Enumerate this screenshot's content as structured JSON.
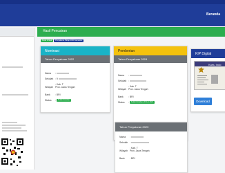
{
  "header": {
    "nav_home": "Beranda"
  },
  "main": {
    "title": "Hasil Pencairan",
    "tags": [
      "Kode Virtual",
      "Penyaluran Tahap 2024 Semester"
    ]
  },
  "cards": {
    "nominasi": {
      "title": "Nominasi",
      "subtitle": "Tahun Penyaluran 2022",
      "rows": [
        {
          "label": "Nama",
          "value": ":"
        },
        {
          "label": "Sekolah",
          "value": ": 9"
        },
        {
          "label": "Wilayah",
          "value": ": Kab. T\nProv. Jawa Tengah"
        },
        {
          "label": "Bank",
          "value": ": BRI"
        },
        {
          "label": "Status",
          "value": ":"
        }
      ],
      "status_badge": "Sudah Dicairkan"
    },
    "pemberian": {
      "title": "Pemberian",
      "subtitle": "Tahun Penyaluran 2024",
      "rows": [
        {
          "label": "Nama",
          "value": ":"
        },
        {
          "label": "Sekolah",
          "value": ":"
        },
        {
          "label": "Wilayah",
          "value": ": Kab. T\nProv. Jawa Tengah"
        },
        {
          "label": "Bank",
          "value": ": BRI"
        },
        {
          "label": "Status",
          "value": ":"
        }
      ],
      "status_badge": "Sudah Dicairkan 28 Juni 2024"
    },
    "tahun2023": {
      "subtitle": "Tahun Penyaluran 2023",
      "rows": [
        {
          "label": "Nama",
          "value": ":"
        },
        {
          "label": "Sekolah",
          "value": ":"
        },
        {
          "label": "Wilayah",
          "value": ": Kab. T\nProv. Jawa Tengah"
        },
        {
          "label": "Bank",
          "value": ": BRI"
        }
      ]
    }
  },
  "kip": {
    "title": "KIP Digital",
    "card_text": "Kartu Indo",
    "download": "Download"
  },
  "colors": {
    "topbar": "#1f3d99",
    "main_header": "#2dad4f",
    "nominasi": "#19b3c7",
    "pemberian": "#f4c20d",
    "status": "#2dad4f",
    "download": "#2f7fd8"
  }
}
